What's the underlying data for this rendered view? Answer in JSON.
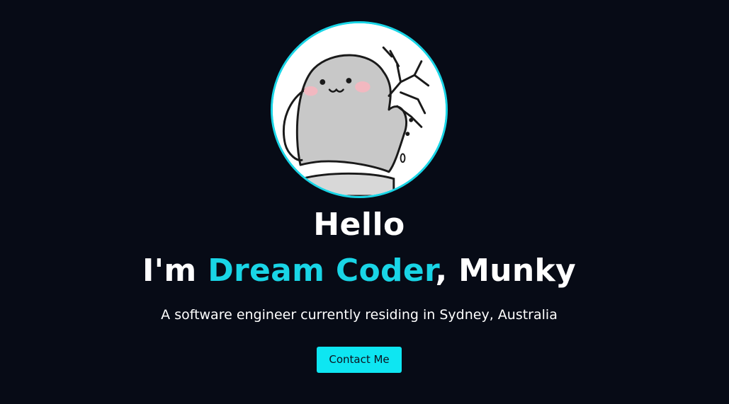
{
  "hero": {
    "greeting": "Hello",
    "headline_prefix": "I'm ",
    "headline_role": "Dream Coder",
    "headline_suffix": ", Munky",
    "tagline": "A software engineer currently residing in Sydney, Australia",
    "cta_label": "Contact Me"
  },
  "avatar": {
    "icon": "cartoon-ghost-avatar"
  },
  "colors": {
    "background": "#070b16",
    "accent": "#19d5e6",
    "button": "#0ee6f2",
    "text": "#ffffff"
  }
}
